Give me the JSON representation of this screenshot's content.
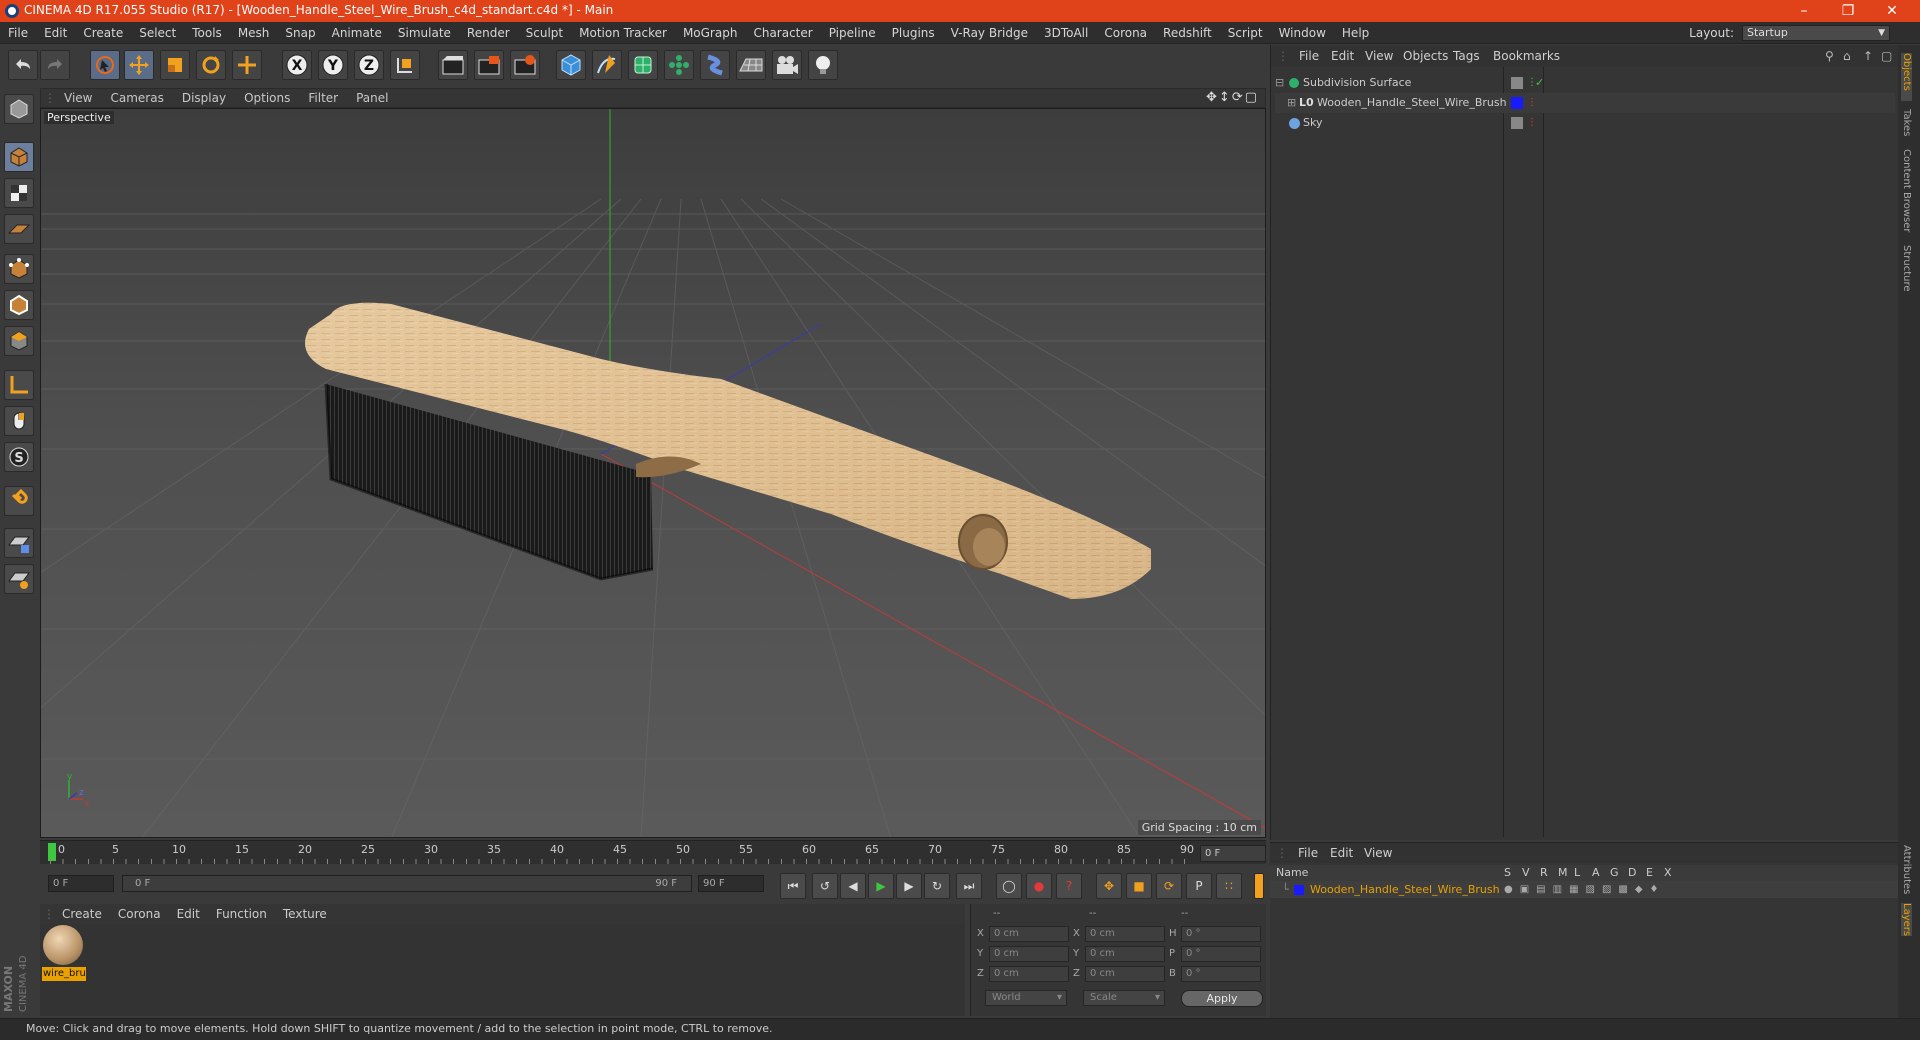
{
  "window": {
    "title": "CINEMA 4D R17.055 Studio (R17) - [Wooden_Handle_Steel_Wire_Brush_c4d_standart.c4d *] - Main",
    "controls": [
      "minimize",
      "restore",
      "close"
    ]
  },
  "menubar": {
    "items": [
      "File",
      "Edit",
      "Create",
      "Select",
      "Tools",
      "Mesh",
      "Snap",
      "Animate",
      "Simulate",
      "Render",
      "Sculpt",
      "Motion Tracker",
      "MoGraph",
      "Character",
      "Pipeline",
      "Plugins",
      "V-Ray Bridge",
      "3DToAll",
      "Corona",
      "Redshift",
      "Script",
      "Window",
      "Help"
    ],
    "layout_label": "Layout:",
    "layout_value": "Startup"
  },
  "toolbar": {
    "icons": [
      "undo-icon",
      "redo-icon",
      "live-selection-icon",
      "move-icon",
      "scale-icon",
      "rotate-icon",
      "recent-tool-icon",
      "x-axis-lock-icon",
      "y-axis-lock-icon",
      "z-axis-lock-icon",
      "coordinate-system-icon",
      "render-view-icon",
      "render-picture-viewer-icon",
      "edit-render-settings-icon",
      "cube-primitive-icon",
      "pen-spline-icon",
      "subdivision-nurbs-icon",
      "array-mograph-icon",
      "deformer-icon",
      "floor-scene-icon",
      "camera-icon",
      "light-icon"
    ],
    "axis_letters": [
      "X",
      "Y",
      "Z"
    ]
  },
  "left_toolbar": {
    "icons": [
      "make-editable-icon",
      "model-mode-icon",
      "texture-mode-icon",
      "workplane-icon",
      "points-mode-icon",
      "edges-mode-icon",
      "polygons-mode-icon",
      "enable-axis-icon",
      "tweak-mode-icon",
      "solo-mode-icon",
      "snapping-icon",
      "workplane-lock-icon",
      "locked-workplane-icon"
    ]
  },
  "viewport": {
    "menu": [
      "View",
      "Cameras",
      "Display",
      "Options",
      "Filter",
      "Panel"
    ],
    "label": "Perspective",
    "grid_spacing": "Grid Spacing : 10 cm",
    "axis_labels": [
      "y",
      "z",
      "x"
    ]
  },
  "timeline": {
    "ticks": [
      "0",
      "5",
      "10",
      "15",
      "20",
      "25",
      "30",
      "35",
      "40",
      "45",
      "50",
      "55",
      "60",
      "65",
      "70",
      "75",
      "80",
      "85",
      "90"
    ],
    "current_frame": "0 F",
    "start_frame": "0 F",
    "range_start": "0 F",
    "range_end": "90 F",
    "end_frame": "90 F"
  },
  "material_manager": {
    "menu": [
      "Create",
      "Corona",
      "Edit",
      "Function",
      "Texture"
    ],
    "materials": [
      {
        "name": "wire_bru"
      }
    ]
  },
  "coordinates": {
    "headers": [
      "--",
      "--",
      "--"
    ],
    "rows": [
      {
        "label1": "X",
        "val1": "0 cm",
        "label2": "X",
        "val2": "0 cm",
        "label3": "H",
        "val3": "0 °"
      },
      {
        "label1": "Y",
        "val1": "0 cm",
        "label2": "Y",
        "val2": "0 cm",
        "label3": "P",
        "val3": "0 °"
      },
      {
        "label1": "Z",
        "val1": "0 cm",
        "label2": "Z",
        "val2": "0 cm",
        "label3": "B",
        "val3": "0 °"
      }
    ],
    "mode": "World",
    "transform": "Scale",
    "apply_label": "Apply"
  },
  "objects_panel": {
    "menu": [
      "File",
      "Edit",
      "View",
      "Objects",
      "Tags",
      "Bookmarks"
    ],
    "objects": [
      {
        "name": "Subdivision Surface",
        "icon": "subdivision-icon"
      },
      {
        "name": "Wooden_Handle_Steel_Wire_Brush",
        "icon": "null-object-icon"
      },
      {
        "name": "Sky",
        "icon": "sky-icon"
      }
    ]
  },
  "layers_panel": {
    "menu": [
      "File",
      "Edit",
      "View"
    ],
    "header_name": "Name",
    "header_columns": [
      "S",
      "V",
      "R",
      "M",
      "L",
      "A",
      "G",
      "D",
      "E",
      "X"
    ],
    "layers": [
      {
        "name": "Wooden_Handle_Steel_Wire_Brush",
        "color": "#1a1aff"
      }
    ]
  },
  "side_tabs": [
    "Objects",
    "Takes",
    "Content Browser",
    "Structure",
    "Attributes",
    "Layers"
  ],
  "status": {
    "text": "Move: Click and drag to move elements. Hold down SHIFT to quantize movement / add to the selection in point mode, CTRL to remove."
  },
  "branding": {
    "logo_text": "MAXON CINEMA 4D"
  },
  "colors": {
    "accent": "#e0421a",
    "selection": "#e8a100",
    "layer_blue": "#1a1aff"
  }
}
